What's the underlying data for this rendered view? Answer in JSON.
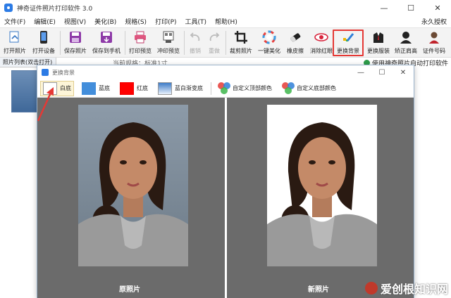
{
  "app": {
    "title": "神奇证件照片打印软件 3.0"
  },
  "window_controls": {
    "minimize": "—",
    "maximize": "☐",
    "close": "✕"
  },
  "menu": {
    "items": [
      "文件(F)",
      "编辑(E)",
      "视图(V)",
      "美化(B)",
      "规格(S)",
      "打印(P)",
      "工具(T)",
      "帮助(H)"
    ],
    "license": "永久授权"
  },
  "toolbar": {
    "items": [
      {
        "label": "打开照片",
        "icon": "open-photo-icon"
      },
      {
        "label": "打开设备",
        "icon": "device-icon"
      },
      {
        "label": "保存照片",
        "icon": "save-icon"
      },
      {
        "label": "保存到手机",
        "icon": "save-phone-icon"
      },
      {
        "label": "打印预览",
        "icon": "print-preview-icon"
      },
      {
        "label": "冲印预览",
        "icon": "photo-print-icon"
      },
      {
        "label": "撤销",
        "icon": "undo-icon"
      },
      {
        "label": "重做",
        "icon": "redo-icon"
      },
      {
        "label": "裁剪照片",
        "icon": "crop-icon"
      },
      {
        "label": "一键美化",
        "icon": "beautify-icon"
      },
      {
        "label": "橡皮擦",
        "icon": "eraser-icon"
      },
      {
        "label": "消除红眼",
        "icon": "red-eye-icon"
      },
      {
        "label": "更换背景",
        "icon": "change-background-icon"
      },
      {
        "label": "更换服装",
        "icon": "change-clothes-icon"
      },
      {
        "label": "矫正肩高",
        "icon": "shoulder-icon"
      },
      {
        "label": "证件号码",
        "icon": "id-number-icon"
      }
    ]
  },
  "left_panel": {
    "header": "照片列表(双击打开)"
  },
  "main_strip": {
    "text": "当前规格：标准1寸",
    "auto_print": "使用神奇照片自动打印软件"
  },
  "dialog": {
    "title": "更换背景",
    "options": [
      {
        "label": "白底",
        "color": "#ffffff"
      },
      {
        "label": "蓝底",
        "color": "#438edb"
      },
      {
        "label": "红底",
        "color": "#ff0000"
      },
      {
        "label": "蓝白渐变底",
        "color": "#5a8fd0"
      }
    ],
    "custom_top": "自定义顶部颜色",
    "custom_bottom": "自定义底部颜色",
    "original_caption": "原照片",
    "new_caption": "新照片"
  },
  "watermark": {
    "text": "爱创根知识网"
  },
  "colors": {
    "highlight_red": "#e53935",
    "pane_gray": "#6b6b6b",
    "app_blue": "#2c7be5"
  }
}
